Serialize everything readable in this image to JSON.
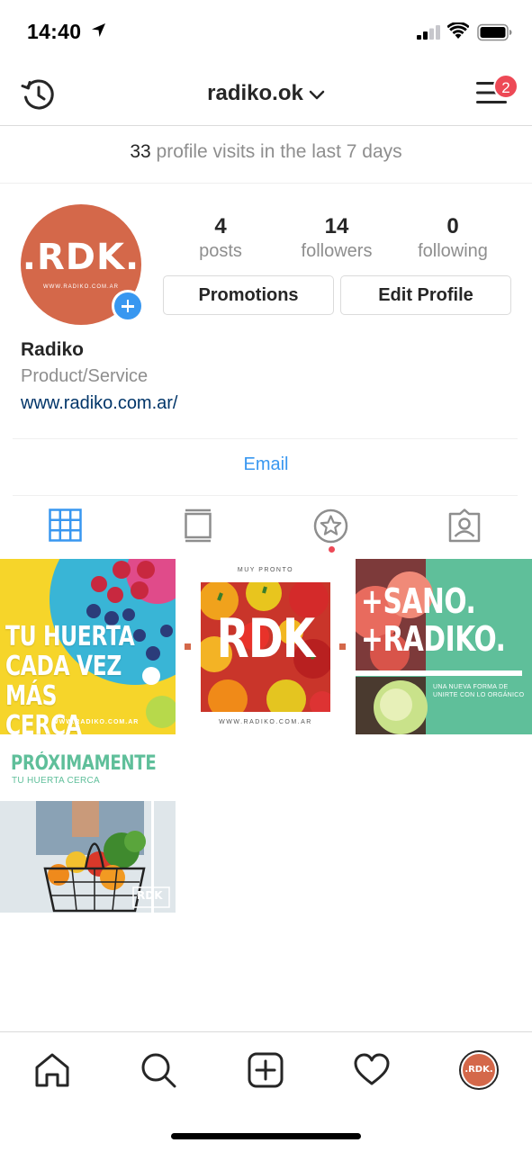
{
  "status_bar": {
    "time": "14:40"
  },
  "header": {
    "username": "radiko.ok",
    "notification_count": "2"
  },
  "visits": {
    "count": "33",
    "text": "profile visits in the last 7 days"
  },
  "profile": {
    "avatar_logo": ".RDK.",
    "avatar_sub": "WWW.RADIKO.COM.AR",
    "name": "Radiko",
    "category": "Product/Service",
    "website": "www.radiko.com.ar/",
    "contact": "Email"
  },
  "stats": [
    {
      "value": "4",
      "label": "posts"
    },
    {
      "value": "14",
      "label": "followers"
    },
    {
      "value": "0",
      "label": "following"
    }
  ],
  "buttons": {
    "promotions": "Promotions",
    "edit_profile": "Edit Profile"
  },
  "posts": [
    {
      "lines": [
        "TU HUERTA",
        "CADA VEZ",
        "MÁS CERCA"
      ],
      "footer": "WWW.RADIKO.COM.AR"
    },
    {
      "top": "MUY PRONTO",
      "logo": "RDK",
      "footer": "WWW.RADIKO.COM.AR"
    },
    {
      "lines": [
        "+SANO.",
        "+RADIKO."
      ],
      "sub": [
        "UNA NUEVA FORMA DE",
        "UNIRTE CON LO ORGÁNICO"
      ]
    },
    {
      "title": "PRÓXIMAMENTE",
      "sub": "TU HUERTA CERCA",
      "logo": "RDK"
    }
  ],
  "bottom_nav": {
    "avatar_logo": ".RDK."
  },
  "colors": {
    "accent_blue": "#3897f0",
    "badge_red": "#ed4956",
    "brand_orange": "#d4684a",
    "brand_green": "#5fbf9a",
    "link_navy": "#003569"
  },
  "icons": [
    "location-arrow-icon",
    "signal-icon",
    "wifi-icon",
    "battery-icon",
    "history-icon",
    "chevron-down-icon",
    "menu-icon",
    "grid-icon",
    "igtv-icon",
    "star-icon",
    "tagged-icon",
    "home-icon",
    "search-icon",
    "add-post-icon",
    "heart-icon"
  ]
}
